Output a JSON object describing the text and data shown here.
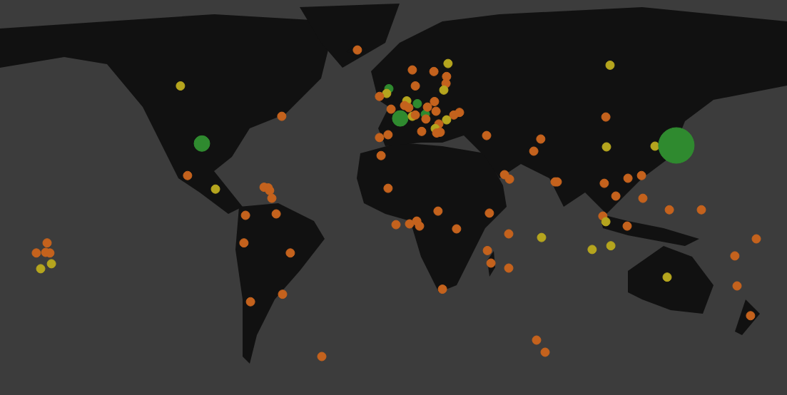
{
  "markers": [
    {
      "color": "#c4621d",
      "kind": "small"
    },
    {
      "color": "#b5a51e",
      "kind": "small"
    },
    {
      "color": "#c4621d",
      "kind": "small"
    },
    {
      "color": "#c4621d",
      "kind": "small"
    },
    {
      "color": "#c4621d",
      "kind": "small"
    },
    {
      "color": "#c4621d",
      "kind": "small"
    },
    {
      "color": "#2f8a2f",
      "kind": "small"
    },
    {
      "color": "#b5a51e",
      "kind": "small"
    },
    {
      "color": "#c4621d",
      "kind": "small"
    },
    {
      "color": "#c4621d",
      "kind": "small"
    },
    {
      "color": "#b5a51e",
      "kind": "small"
    },
    {
      "color": "#b5a51e",
      "kind": "small"
    },
    {
      "color": "#2f8a2f",
      "kind": "small"
    },
    {
      "color": "#c4621d",
      "kind": "small"
    },
    {
      "color": "#c4621d",
      "kind": "small"
    },
    {
      "color": "#c4621d",
      "kind": "small"
    },
    {
      "color": "#c4621d",
      "kind": "small"
    },
    {
      "color": "#2f8a2f",
      "kind": "medium"
    },
    {
      "color": "#b5a51e",
      "kind": "small"
    },
    {
      "color": "#c4621d",
      "kind": "small"
    },
    {
      "color": "#2f8a2f",
      "kind": "small"
    },
    {
      "color": "#c4621d",
      "kind": "small"
    },
    {
      "color": "#c4621d",
      "kind": "small"
    },
    {
      "color": "#c4621d",
      "kind": "small"
    },
    {
      "color": "#c4621d",
      "kind": "small"
    },
    {
      "color": "#c4621d",
      "kind": "small"
    },
    {
      "color": "#b5a51e",
      "kind": "small"
    },
    {
      "color": "#c4621d",
      "kind": "small"
    },
    {
      "color": "#b5a51e",
      "kind": "small"
    },
    {
      "color": "#c4621d",
      "kind": "small"
    },
    {
      "color": "#c4621d",
      "kind": "small"
    },
    {
      "color": "#c4621d",
      "kind": "small"
    },
    {
      "color": "#c4621d",
      "kind": "small"
    },
    {
      "color": "#c4621d",
      "kind": "small"
    },
    {
      "color": "#c4621d",
      "kind": "small"
    },
    {
      "color": "#c4621d",
      "kind": "small"
    },
    {
      "color": "#c4621d",
      "kind": "small"
    },
    {
      "color": "#c4621d",
      "kind": "small"
    },
    {
      "color": "#c4621d",
      "kind": "small"
    },
    {
      "color": "#c4621d",
      "kind": "small"
    },
    {
      "color": "#c4621d",
      "kind": "small"
    },
    {
      "color": "#c4621d",
      "kind": "small"
    },
    {
      "color": "#c4621d",
      "kind": "small"
    },
    {
      "color": "#c4621d",
      "kind": "small"
    },
    {
      "color": "#c4621d",
      "kind": "small"
    },
    {
      "color": "#c4621d",
      "kind": "small"
    },
    {
      "color": "#c4621d",
      "kind": "small"
    },
    {
      "color": "#c4621d",
      "kind": "small"
    },
    {
      "color": "#c4621d",
      "kind": "small"
    },
    {
      "color": "#c4621d",
      "kind": "small"
    },
    {
      "color": "#b5a51e",
      "kind": "small"
    },
    {
      "color": "#b5a51e",
      "kind": "small"
    },
    {
      "color": "#c4621d",
      "kind": "small"
    },
    {
      "color": "#2f8a2f",
      "kind": "medium"
    },
    {
      "color": "#c4621d",
      "kind": "small"
    },
    {
      "color": "#b5a51e",
      "kind": "small"
    },
    {
      "color": "#c4621d",
      "kind": "small"
    },
    {
      "color": "#c4621d",
      "kind": "small"
    },
    {
      "color": "#c4621d",
      "kind": "small"
    },
    {
      "color": "#c4621d",
      "kind": "small"
    },
    {
      "color": "#c4621d",
      "kind": "small"
    },
    {
      "color": "#c4621d",
      "kind": "small"
    },
    {
      "color": "#c4621d",
      "kind": "small"
    },
    {
      "color": "#c4621d",
      "kind": "small"
    },
    {
      "color": "#c4621d",
      "kind": "small"
    },
    {
      "color": "#c4621d",
      "kind": "small"
    },
    {
      "color": "#c4621d",
      "kind": "small"
    },
    {
      "color": "#c4621d",
      "kind": "small"
    },
    {
      "color": "#c4621d",
      "kind": "small"
    },
    {
      "color": "#c4621d",
      "kind": "small"
    },
    {
      "color": "#b5a51e",
      "kind": "small"
    },
    {
      "color": "#b5a51e",
      "kind": "small"
    },
    {
      "color": "#b5a51e",
      "kind": "small"
    },
    {
      "color": "#c4621d",
      "kind": "small"
    },
    {
      "color": "#b5a51e",
      "kind": "small"
    },
    {
      "color": "#b5a51e",
      "kind": "small"
    },
    {
      "color": "#2f8a2f",
      "kind": "large"
    },
    {
      "color": "#c4621d",
      "kind": "small"
    },
    {
      "color": "#c4621d",
      "kind": "small"
    },
    {
      "color": "#c4621d",
      "kind": "small"
    },
    {
      "color": "#c4621d",
      "kind": "small"
    },
    {
      "color": "#c4621d",
      "kind": "small"
    },
    {
      "color": "#c4621d",
      "kind": "small"
    },
    {
      "color": "#c4621d",
      "kind": "small"
    },
    {
      "color": "#c4621d",
      "kind": "small"
    },
    {
      "color": "#c4621d",
      "kind": "small"
    },
    {
      "color": "#b5a51e",
      "kind": "small"
    },
    {
      "color": "#c4621d",
      "kind": "small"
    },
    {
      "color": "#b5a51e",
      "kind": "small"
    },
    {
      "color": "#b5a51e",
      "kind": "small"
    },
    {
      "color": "#b5a51e",
      "kind": "small"
    },
    {
      "color": "#c4621d",
      "kind": "small"
    },
    {
      "color": "#c4621d",
      "kind": "small"
    },
    {
      "color": "#c4621d",
      "kind": "small"
    },
    {
      "color": "#c4621d",
      "kind": "small"
    },
    {
      "color": "#c4621d",
      "kind": "small"
    },
    {
      "color": "#c4621d",
      "kind": "small"
    },
    {
      "color": "#c4621d",
      "kind": "small"
    },
    {
      "color": "#c4621d",
      "kind": "small"
    },
    {
      "color": "#c4621d",
      "kind": "small"
    },
    {
      "color": "#c4621d",
      "kind": "small"
    },
    {
      "color": "#c4621d",
      "kind": "small"
    }
  ]
}
